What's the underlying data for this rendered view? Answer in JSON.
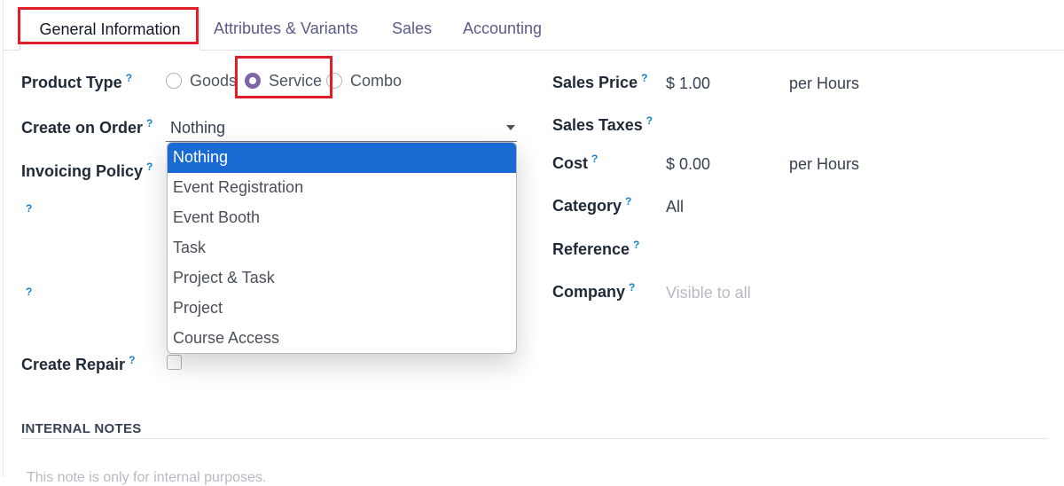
{
  "tabs": [
    {
      "label": "General Information",
      "active": true
    },
    {
      "label": "Attributes & Variants"
    },
    {
      "label": "Sales"
    },
    {
      "label": "Accounting"
    }
  ],
  "help_marker": "?",
  "left_fields": {
    "product_type": {
      "label": "Product Type",
      "options": [
        "Goods",
        "Service",
        "Combo"
      ],
      "selected": "Service"
    },
    "create_on_order": {
      "label": "Create on Order",
      "value": "Nothing",
      "options": [
        "Nothing",
        "Event Registration",
        "Event Booth",
        "Task",
        "Project & Task",
        "Project",
        "Course Access"
      ]
    },
    "invoicing_policy": {
      "label": "Invoicing Policy"
    },
    "create_repair": {
      "label": "Create Repair",
      "checked": false
    }
  },
  "right_fields": {
    "sales_price": {
      "label": "Sales Price",
      "value": "$ 1.00",
      "unit": "per  Hours"
    },
    "sales_taxes": {
      "label": "Sales Taxes"
    },
    "cost": {
      "label": "Cost",
      "value": "$ 0.00",
      "unit": "per Hours"
    },
    "category": {
      "label": "Category",
      "value": "All"
    },
    "reference": {
      "label": "Reference"
    },
    "company": {
      "label": "Company",
      "placeholder": "Visible to all"
    }
  },
  "internal_notes": {
    "title": "INTERNAL NOTES",
    "placeholder": "This note is only for internal purposes."
  },
  "colors": {
    "accent": "#7e64a6",
    "highlight": "#e11d2a",
    "selected_option": "#1a6ad4",
    "help": "#1782c5"
  }
}
